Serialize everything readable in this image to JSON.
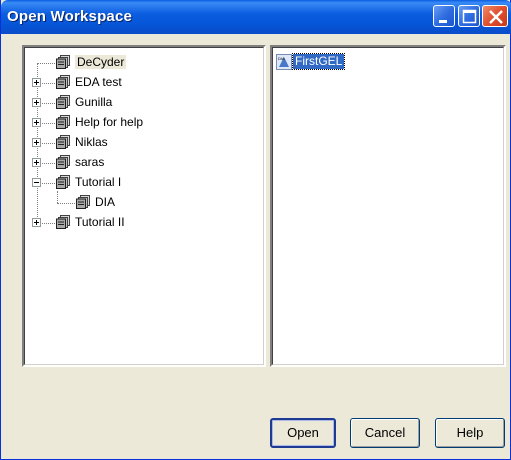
{
  "window": {
    "title": "Open Workspace"
  },
  "tree": {
    "items": [
      {
        "label": "DeCyder",
        "expander": "none",
        "selected": true
      },
      {
        "label": "EDA test",
        "expander": "plus"
      },
      {
        "label": "Gunilla",
        "expander": "plus"
      },
      {
        "label": "Help for help",
        "expander": "plus"
      },
      {
        "label": "Niklas",
        "expander": "plus"
      },
      {
        "label": "saras",
        "expander": "plus"
      },
      {
        "label": "Tutorial I",
        "expander": "minus"
      },
      {
        "label": "DIA",
        "expander": "none",
        "child": true
      },
      {
        "label": "Tutorial II",
        "expander": "plus"
      }
    ]
  },
  "files": {
    "items": [
      {
        "label": "FirstGEL",
        "icon": "gel-file-icon",
        "selected": true
      }
    ]
  },
  "buttons": {
    "open": "Open",
    "cancel": "Cancel",
    "help": "Help"
  },
  "colors": {
    "titlebar": "#0556d8",
    "selection": "#316ac5",
    "dialog_bg": "#ece9d8"
  }
}
